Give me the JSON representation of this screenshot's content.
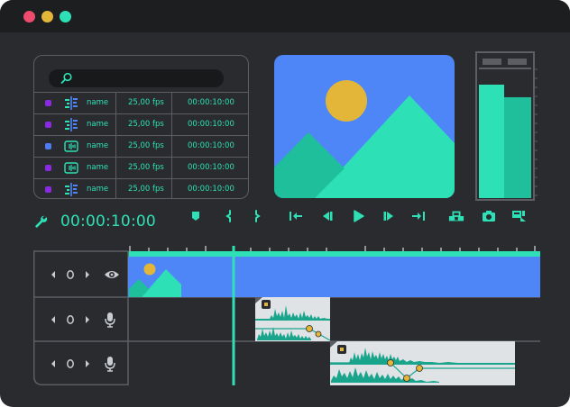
{
  "window": {
    "traffic_lights": [
      {
        "name": "close",
        "color": "#ee4b6e"
      },
      {
        "name": "minimize",
        "color": "#e3b63a"
      },
      {
        "name": "maximize",
        "color": "#2ee0b6"
      }
    ]
  },
  "media_panel": {
    "search": {
      "placeholder": "",
      "icon": "search-icon"
    },
    "rows": [
      {
        "color": "#8a2be2",
        "icon": "split-audio-icon",
        "name": "name",
        "fps": "25,00 fps",
        "duration": "00:00:10:00"
      },
      {
        "color": "#8a2be2",
        "icon": "split-audio-icon",
        "name": "name",
        "fps": "25,00 fps",
        "duration": "00:00:10:00"
      },
      {
        "color": "#4d7cf5",
        "icon": "waveform-icon",
        "name": "name",
        "fps": "25,00 fps",
        "duration": "00:00:10:00"
      },
      {
        "color": "#8a2be2",
        "icon": "waveform-icon",
        "name": "name",
        "fps": "25,00 fps",
        "duration": "00:00:10:00"
      },
      {
        "color": "#8a2be2",
        "icon": "split-audio-icon",
        "name": "name",
        "fps": "25,00 fps",
        "duration": "00:00:10:00"
      }
    ]
  },
  "toolbar": {
    "timecode": "00:00:10:00",
    "tools": [
      "wrench-icon"
    ],
    "markers": [
      "marker-icon",
      "in-point-icon",
      "out-point-icon"
    ],
    "transport": [
      "go-to-start-icon",
      "step-back-icon",
      "play-icon",
      "step-forward-icon",
      "go-to-end-icon"
    ],
    "extras": [
      "lift-icon",
      "snapshot-icon",
      "export-icon"
    ]
  },
  "tracks": [
    {
      "kind": "video",
      "controls": [
        "prev-icon",
        "loop-icon",
        "next-icon",
        "eye-icon"
      ]
    },
    {
      "kind": "audio",
      "controls": [
        "prev-icon",
        "loop-icon",
        "next-icon",
        "microphone-icon"
      ]
    },
    {
      "kind": "audio",
      "controls": [
        "prev-icon",
        "loop-icon",
        "next-icon",
        "microphone-icon"
      ]
    }
  ],
  "colors": {
    "accent": "#2ee0b6",
    "clip_blue": "#4f86f7",
    "background": "#2a2b2e",
    "titlebar": "#1d1e20",
    "border": "#5c5e63"
  }
}
